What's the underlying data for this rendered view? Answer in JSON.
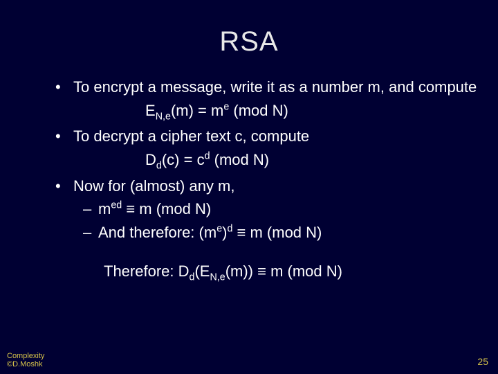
{
  "title": "RSA",
  "bullets": {
    "b1": "To encrypt a message, write it as a number m, and compute",
    "f1_lhs": "E",
    "f1_sub": "N,e",
    "f1_mid1": "(m)  =   m",
    "f1_sup": "e",
    "f1_tail": "    (mod N)",
    "b2": "To decrypt a cipher text c, compute",
    "f2_lhs": "D",
    "f2_sub": "d",
    "f2_mid1": "(c)   = c",
    "f2_sup": "d",
    "f2_tail": "    (mod N)",
    "b3": "Now for (almost) any m,",
    "b3a_pre": "m",
    "b3a_sup": "ed",
    "b3a_tail": "  ≡  m (mod N)",
    "b3b_pre": "And therefore:  (m",
    "b3b_sup1": "e",
    "b3b_mid": ")",
    "b3b_sup2": "d",
    "b3b_tail": "  ≡   m (mod N)"
  },
  "conclusion": {
    "pre": "Therefore: D",
    "sub1": "d",
    "mid1": "(E",
    "sub2": "N,e",
    "mid2": "(m))  ≡   m    (mod N)"
  },
  "footer": {
    "left_line1": "Complexity",
    "left_line2": "©D.Moshk",
    "page": "25"
  }
}
